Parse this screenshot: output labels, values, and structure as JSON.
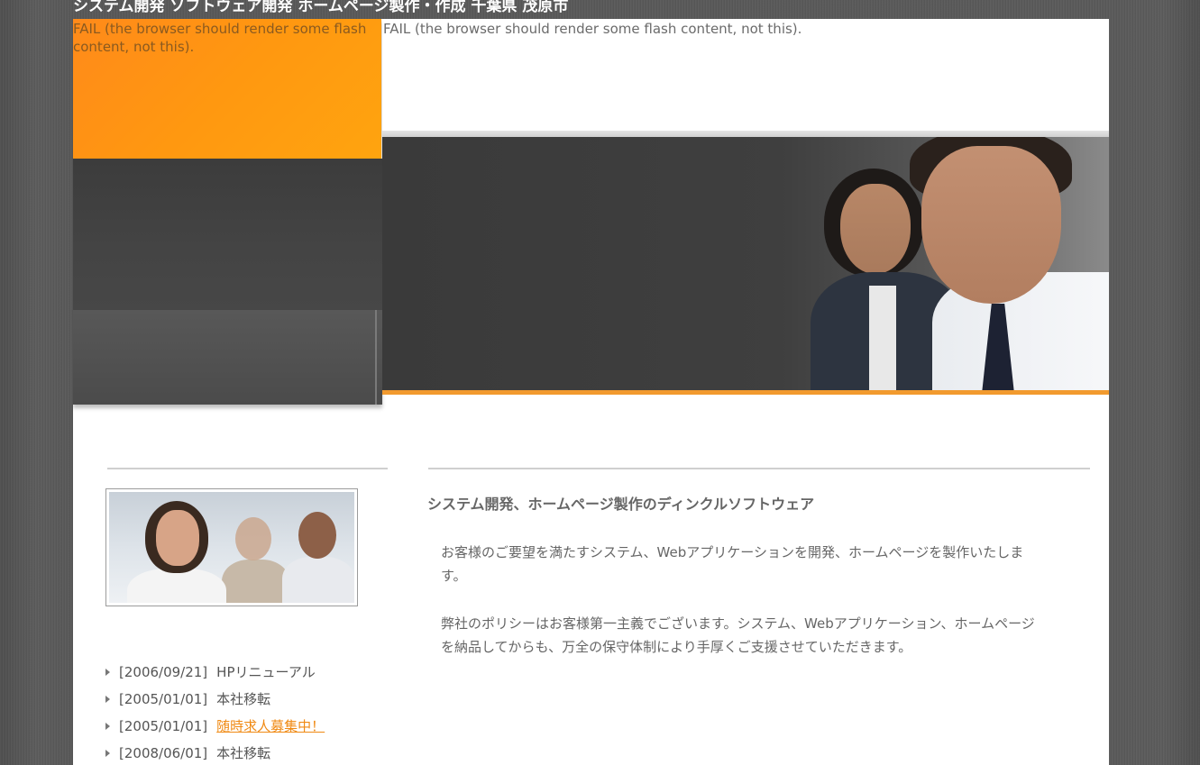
{
  "site": {
    "title": "システム開発 ソフトウェア開発 ホームページ製作・作成 千葉県 茂原市"
  },
  "header": {
    "flash_fallback_left": "FAIL (the browser should render some flash content, not this).",
    "flash_fallback_right": "FAIL (the browser should render some flash content, not this)."
  },
  "colors": {
    "accent_orange": "#f29a2e",
    "link_orange": "#f08a14",
    "background_gray": "#5a5a5a"
  },
  "news": [
    {
      "date": "[2006/09/21]",
      "text": "HPリニューアル",
      "is_link": false
    },
    {
      "date": "[2005/01/01]",
      "text": "本社移転",
      "is_link": false
    },
    {
      "date": "[2005/01/01]",
      "text": "随時求人募集中！",
      "is_link": true
    },
    {
      "date": "[2008/06/01]",
      "text": "本社移転",
      "is_link": false
    }
  ],
  "main": {
    "heading": "システム開発、ホームページ製作のディンクルソフトウェア",
    "paragraph1": "お客様のご要望を満たすシステム、Webアプリケーションを開発、ホームページを製作いたします。",
    "paragraph2": "弊社のポリシーはお客様第一主義でございます。システム、Webアプリケーション、ホームページを納品してからも、万全の保守体制により手厚くご支援させていただきます。"
  }
}
